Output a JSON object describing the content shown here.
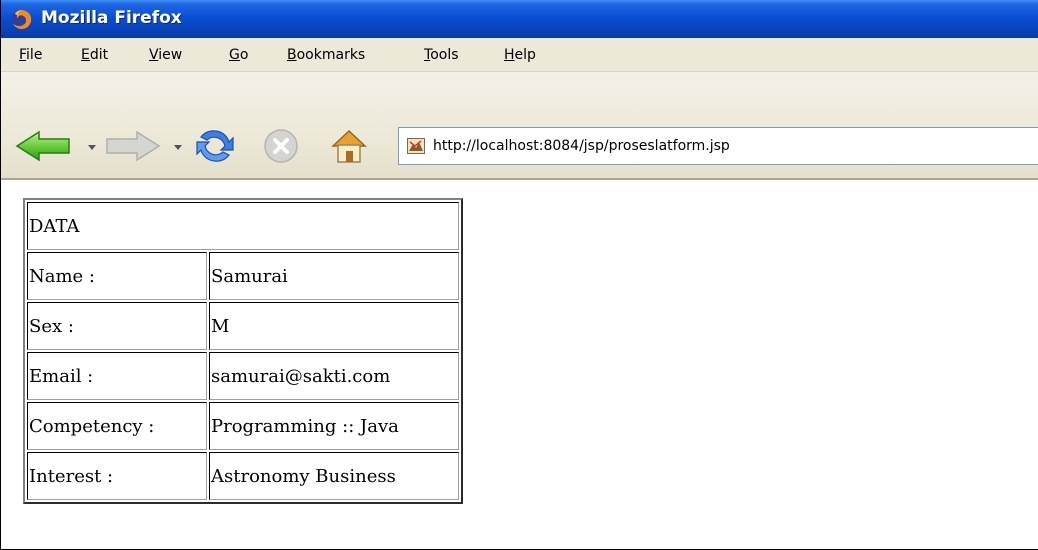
{
  "window": {
    "title": "Mozilla Firefox"
  },
  "menu": {
    "items": [
      {
        "label": "File",
        "key": "F",
        "rest": "ile"
      },
      {
        "label": "Edit",
        "key": "E",
        "rest": "dit"
      },
      {
        "label": "View",
        "key": "V",
        "rest": "iew"
      },
      {
        "label": "Go",
        "key": "G",
        "rest": "o"
      },
      {
        "label": "Bookmarks",
        "key": "B",
        "rest": "ookmarks"
      },
      {
        "label": "Tools",
        "key": "T",
        "rest": "ools"
      },
      {
        "label": "Help",
        "key": "H",
        "rest": "elp"
      }
    ]
  },
  "toolbar": {
    "buttons": [
      "back-icon",
      "forward-icon",
      "reload-icon",
      "stop-icon",
      "home-icon"
    ],
    "url": "http://localhost:8084/jsp/proseslatform.jsp"
  },
  "table": {
    "header": "DATA",
    "rows": [
      {
        "label": "Name :",
        "value": "Samurai"
      },
      {
        "label": "Sex :",
        "value": "M"
      },
      {
        "label": "Email :",
        "value": "samurai@sakti.com"
      },
      {
        "label": "Competency :",
        "value": "Programming :: Java"
      },
      {
        "label": "Interest :",
        "value": "Astronomy Business"
      }
    ]
  },
  "colors": {
    "titlebar": "#0a4fd3",
    "chrome": "#ece9d8",
    "url_border": "#7f9db9"
  }
}
